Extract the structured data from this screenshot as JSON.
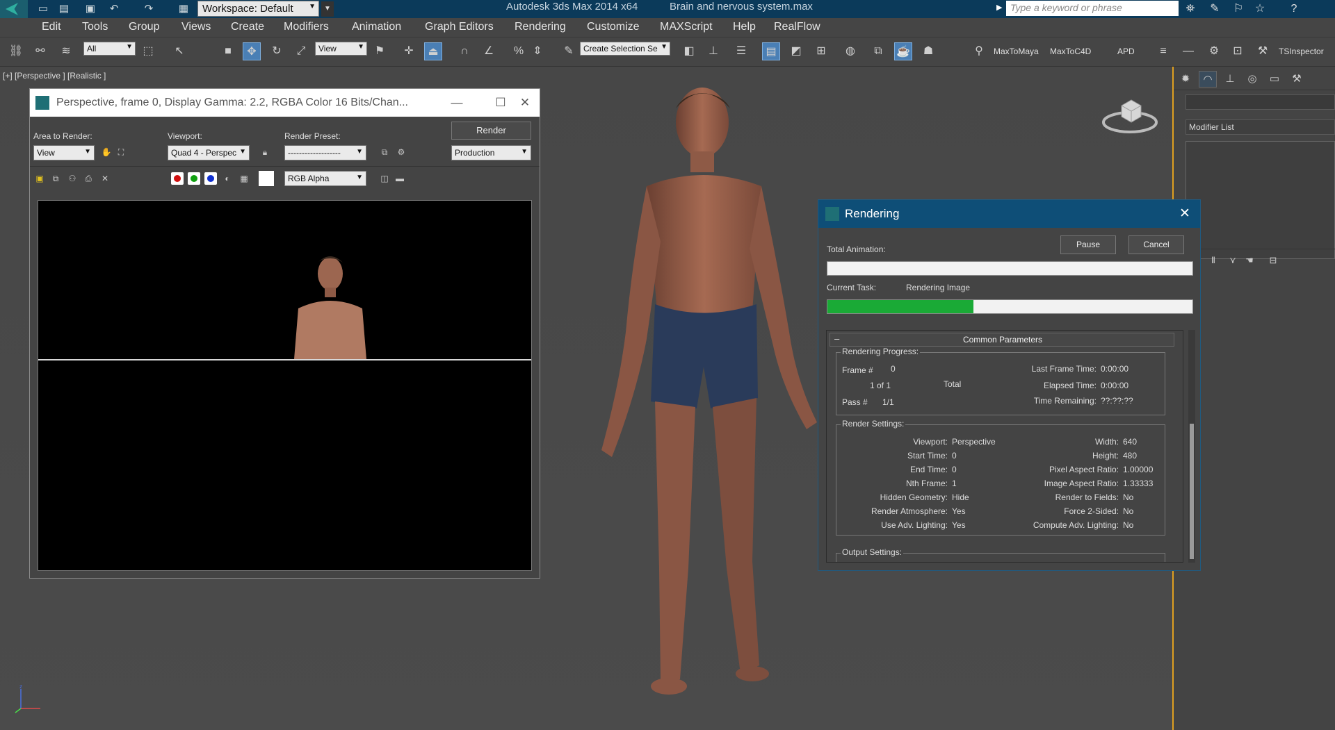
{
  "app": {
    "title": "Autodesk 3ds Max  2014 x64",
    "file": "Brain and nervous system.max",
    "workspace": "Workspace: Default",
    "search_placeholder": "Type a keyword or phrase"
  },
  "menu": [
    "Edit",
    "Tools",
    "Group",
    "Views",
    "Create",
    "Modifiers",
    "Animation",
    "Graph Editors",
    "Rendering",
    "Customize",
    "MAXScript",
    "Help",
    "RealFlow"
  ],
  "toolbar": {
    "selection_filter": "All",
    "ref_coord": "View",
    "named_selection": "Create Selection Se",
    "plugins": [
      "MaxToMaya",
      "MaxToC4D",
      "APD",
      "TSInspector"
    ]
  },
  "viewport": {
    "label": "[+] [Perspective ] [Realistic ]"
  },
  "cmdpanel": {
    "modifier_list": "Modifier List"
  },
  "frame_window": {
    "title": "Perspective, frame 0, Display Gamma: 2.2, RGBA Color 16 Bits/Chan...",
    "area_label": "Area to Render:",
    "area_value": "View",
    "viewport_label": "Viewport:",
    "viewport_value": "Quad 4 - Perspec",
    "preset_label": "Render Preset:",
    "preset_value": "-------------------",
    "render_button": "Render",
    "mode_value": "Production",
    "channel_value": "RGB Alpha"
  },
  "render_dialog": {
    "title": "Rendering",
    "pause": "Pause",
    "cancel": "Cancel",
    "total_animation_label": "Total Animation:",
    "total_progress": 0,
    "current_task_label": "Current Task:",
    "current_task_value": "Rendering Image",
    "task_progress": 0.4,
    "rollout_minus": "–",
    "rollout_title": "Common Parameters",
    "progress": {
      "title": "Rendering Progress:",
      "frame_label": "Frame #",
      "frame_value": "0",
      "of_count": "1  of  1",
      "total_label": "Total",
      "pass_label": "Pass #",
      "pass_value": "1/1",
      "last_frame_label": "Last Frame Time:",
      "last_frame_value": "0:00:00",
      "elapsed_label": "Elapsed Time:",
      "elapsed_value": "0:00:00",
      "remaining_label": "Time Remaining:",
      "remaining_value": "??:??:??"
    },
    "settings": {
      "title": "Render Settings:",
      "left": [
        {
          "k": "Viewport:",
          "v": "Perspective"
        },
        {
          "k": "Start Time:",
          "v": "0"
        },
        {
          "k": "End Time:",
          "v": "0"
        },
        {
          "k": "Nth Frame:",
          "v": "1"
        },
        {
          "k": "Hidden Geometry:",
          "v": "Hide"
        },
        {
          "k": "Render Atmosphere:",
          "v": "Yes"
        },
        {
          "k": "Use Adv. Lighting:",
          "v": "Yes"
        }
      ],
      "right": [
        {
          "k": "Width:",
          "v": "640"
        },
        {
          "k": "Height:",
          "v": "480"
        },
        {
          "k": "Pixel Aspect Ratio:",
          "v": "1.00000"
        },
        {
          "k": "Image Aspect Ratio:",
          "v": "1.33333"
        },
        {
          "k": "Render to Fields:",
          "v": "No"
        },
        {
          "k": "Force 2-Sided:",
          "v": "No"
        },
        {
          "k": "Compute Adv. Lighting:",
          "v": "No"
        }
      ]
    },
    "output_title": "Output Settings:"
  },
  "colors": {
    "titlebar": "#0b3a5a",
    "dialog_title": "#0e4e77",
    "progress_fill": "#1aaa36",
    "viewport_border": "#e0a020",
    "active_tool": "#4a7fb5"
  },
  "icons": [
    "app-logo-icon",
    "new-icon",
    "open-icon",
    "save-icon",
    "undo-icon",
    "redo-icon",
    "search-icon",
    "help-icon",
    "star-icon",
    "select-link-icon",
    "move-icon",
    "rotate-icon",
    "scale-icon",
    "snap-icon",
    "mirror-icon",
    "align-icon",
    "render-icon",
    "close-icon",
    "minimize-icon",
    "maximize-icon"
  ]
}
